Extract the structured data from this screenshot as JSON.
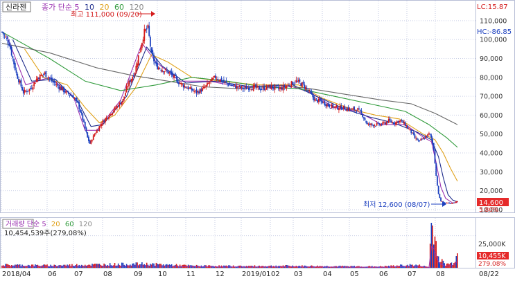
{
  "colors": {
    "up": "#d41b1b",
    "down": "#1b3fbf",
    "ma5": "#9a30b0",
    "ma10": "#1c2a8a",
    "ma20": "#e0a11a",
    "ma60": "#2f9a3a",
    "ma120": "#666666",
    "last_badge": "#e52a2a",
    "grid": "#c9cfe6",
    "frame": "#b7bed6"
  },
  "price_panel": {
    "stock_name": "신라젠",
    "ma_legend": [
      {
        "label": "종가 단순 5",
        "color": "#9a30b0"
      },
      {
        "label": "10",
        "color": "#1c2a8a"
      },
      {
        "label": "20",
        "color": "#e0a11a"
      },
      {
        "label": "60",
        "color": "#2f9a3a"
      },
      {
        "label": "120",
        "color": "#777777"
      }
    ],
    "lc_label": "LC:15.87",
    "hc_label": "HC:-86.85",
    "high_annotation": "최고 111,000 (09/20)",
    "low_annotation": "최저 12,600 (08/07)",
    "last_price": "14,600",
    "last_change": "5.80%",
    "y_ticks": [
      "110,000",
      "100,000",
      "90,000",
      "80,000",
      "70,000",
      "60,000",
      "50,000",
      "40,000",
      "30,000",
      "20,000",
      "10,000"
    ]
  },
  "volume_panel": {
    "title": "거래량 단순 5",
    "ma_legend": [
      {
        "label": "20",
        "color": "#e0a11a"
      },
      {
        "label": "60",
        "color": "#2f9a3a"
      },
      {
        "label": "120",
        "color": "#777777"
      }
    ],
    "volume_info": "10,454,539주(279,08%)",
    "y_tick": "25,000K",
    "last_volume": "10,455K",
    "last_ratio": "279.08%"
  },
  "x_axis": {
    "labels": [
      "2018/04",
      "06",
      "07",
      "08",
      "09",
      "10",
      "11",
      "12",
      "2019/01",
      "02",
      "03",
      "04",
      "05",
      "06",
      "07",
      "08",
      "08/22"
    ]
  },
  "chart_data": {
    "type": "candlestick",
    "x_labels": [
      "2018/04",
      "06",
      "07",
      "08",
      "09",
      "10",
      "11",
      "12",
      "2019/01",
      "02",
      "03",
      "04",
      "05",
      "06",
      "07",
      "08",
      "08/22"
    ],
    "price_y_range": [
      10000,
      118000
    ],
    "volume_y_range": [
      0,
      35000
    ],
    "volume_unit": "K",
    "close_series": {
      "name": "종가",
      "points": [
        [
          0,
          104000
        ],
        [
          6,
          98000
        ],
        [
          12,
          82000
        ],
        [
          18,
          72000
        ],
        [
          24,
          74000
        ],
        [
          30,
          80000
        ],
        [
          36,
          82000
        ],
        [
          42,
          78000
        ],
        [
          48,
          75000
        ],
        [
          54,
          72000
        ],
        [
          60,
          70000
        ],
        [
          64,
          66000
        ],
        [
          68,
          58000
        ],
        [
          72,
          48000
        ],
        [
          74,
          45000
        ],
        [
          78,
          50000
        ],
        [
          84,
          56000
        ],
        [
          90,
          60000
        ],
        [
          96,
          64000
        ],
        [
          102,
          68000
        ],
        [
          106,
          76000
        ],
        [
          112,
          83000
        ],
        [
          116,
          94000
        ],
        [
          120,
          104000
        ],
        [
          123,
          106000
        ],
        [
          126,
          92000
        ],
        [
          130,
          86000
        ],
        [
          136,
          84000
        ],
        [
          142,
          82000
        ],
        [
          148,
          78000
        ],
        [
          152,
          76000
        ],
        [
          158,
          74000
        ],
        [
          164,
          72000
        ],
        [
          170,
          74000
        ],
        [
          176,
          78000
        ],
        [
          180,
          80000
        ],
        [
          186,
          78000
        ],
        [
          192,
          76000
        ],
        [
          198,
          75000
        ],
        [
          204,
          74000
        ],
        [
          210,
          75000
        ],
        [
          218,
          74000
        ],
        [
          226,
          75000
        ],
        [
          234,
          74000
        ],
        [
          242,
          76000
        ],
        [
          248,
          78000
        ],
        [
          254,
          76000
        ],
        [
          258,
          73000
        ],
        [
          264,
          68000
        ],
        [
          270,
          67000
        ],
        [
          276,
          65000
        ],
        [
          282,
          64000
        ],
        [
          288,
          64000
        ],
        [
          294,
          63000
        ],
        [
          300,
          63000
        ],
        [
          304,
          60000
        ],
        [
          308,
          55000
        ],
        [
          314,
          55000
        ],
        [
          320,
          55000
        ],
        [
          326,
          57000
        ],
        [
          330,
          56000
        ],
        [
          336,
          57000
        ],
        [
          340,
          55000
        ],
        [
          344,
          52000
        ],
        [
          348,
          48000
        ],
        [
          352,
          46000
        ],
        [
          356,
          48000
        ],
        [
          360,
          50000
        ],
        [
          362,
          48000
        ],
        [
          364,
          42000
        ],
        [
          366,
          28000
        ],
        [
          368,
          18000
        ],
        [
          370,
          14500
        ],
        [
          372,
          14000
        ],
        [
          374,
          13500
        ],
        [
          376,
          13500
        ],
        [
          378,
          13000
        ],
        [
          380,
          13500
        ],
        [
          382,
          14000
        ],
        [
          384,
          14600
        ]
      ]
    },
    "moving_averages": [
      {
        "name": "5",
        "color": "#9a30b0",
        "points": [
          [
            4,
            102000
          ],
          [
            20,
            76000
          ],
          [
            40,
            80000
          ],
          [
            60,
            70000
          ],
          [
            70,
            52000
          ],
          [
            80,
            52000
          ],
          [
            100,
            68000
          ],
          [
            118,
            98000
          ],
          [
            130,
            88000
          ],
          [
            150,
            78000
          ],
          [
            175,
            78000
          ],
          [
            200,
            75000
          ],
          [
            240,
            76000
          ],
          [
            260,
            72000
          ],
          [
            280,
            64000
          ],
          [
            300,
            62000
          ],
          [
            320,
            55000
          ],
          [
            340,
            55000
          ],
          [
            356,
            48000
          ],
          [
            362,
            46000
          ],
          [
            366,
            35000
          ],
          [
            370,
            22000
          ],
          [
            374,
            16000
          ],
          [
            380,
            13500
          ],
          [
            384,
            13800
          ]
        ]
      },
      {
        "name": "10",
        "color": "#1c2a8a",
        "points": [
          [
            9,
            100000
          ],
          [
            25,
            78000
          ],
          [
            45,
            79000
          ],
          [
            65,
            66000
          ],
          [
            75,
            54000
          ],
          [
            85,
            55000
          ],
          [
            105,
            70000
          ],
          [
            122,
            96000
          ],
          [
            135,
            86000
          ],
          [
            155,
            77000
          ],
          [
            180,
            78000
          ],
          [
            210,
            75000
          ],
          [
            245,
            76000
          ],
          [
            265,
            70000
          ],
          [
            290,
            63000
          ],
          [
            310,
            59000
          ],
          [
            330,
            56000
          ],
          [
            350,
            51000
          ],
          [
            362,
            47000
          ],
          [
            368,
            38000
          ],
          [
            372,
            27000
          ],
          [
            376,
            18000
          ],
          [
            380,
            15000
          ],
          [
            384,
            14200
          ]
        ]
      },
      {
        "name": "20",
        "color": "#e0a11a",
        "points": [
          [
            19,
            95000
          ],
          [
            35,
            80000
          ],
          [
            55,
            76000
          ],
          [
            70,
            64000
          ],
          [
            82,
            56000
          ],
          [
            95,
            60000
          ],
          [
            112,
            74000
          ],
          [
            126,
            92000
          ],
          [
            140,
            88000
          ],
          [
            160,
            80000
          ],
          [
            185,
            78000
          ],
          [
            215,
            76000
          ],
          [
            250,
            76000
          ],
          [
            270,
            69000
          ],
          [
            295,
            63000
          ],
          [
            315,
            60000
          ],
          [
            335,
            58000
          ],
          [
            355,
            50000
          ],
          [
            365,
            47000
          ],
          [
            372,
            40000
          ],
          [
            378,
            32000
          ],
          [
            384,
            25000
          ]
        ]
      },
      {
        "name": "60",
        "color": "#2f9a3a",
        "points": [
          [
            0,
            104000
          ],
          [
            40,
            90000
          ],
          [
            70,
            78000
          ],
          [
            100,
            73000
          ],
          [
            130,
            76000
          ],
          [
            160,
            80000
          ],
          [
            190,
            78000
          ],
          [
            220,
            75000
          ],
          [
            250,
            74000
          ],
          [
            280,
            70000
          ],
          [
            310,
            66000
          ],
          [
            340,
            62000
          ],
          [
            360,
            55000
          ],
          [
            375,
            48000
          ],
          [
            384,
            43000
          ]
        ]
      },
      {
        "name": "120",
        "color": "#666666",
        "points": [
          [
            0,
            98000
          ],
          [
            40,
            93000
          ],
          [
            80,
            85000
          ],
          [
            110,
            81000
          ],
          [
            140,
            78000
          ],
          [
            170,
            75000
          ],
          [
            200,
            74000
          ],
          [
            230,
            76000
          ],
          [
            260,
            74000
          ],
          [
            290,
            71000
          ],
          [
            320,
            68000
          ],
          [
            345,
            66000
          ],
          [
            365,
            61000
          ],
          [
            384,
            55000
          ]
        ]
      }
    ],
    "extremes": {
      "high": 111000,
      "high_date": "09/20",
      "low": 12600,
      "low_date": "08/07"
    },
    "volume_profile": [
      [
        0,
        2200
      ],
      [
        40,
        1800
      ],
      [
        80,
        2500
      ],
      [
        120,
        3000
      ],
      [
        160,
        1600
      ],
      [
        200,
        1300
      ],
      [
        240,
        1500
      ],
      [
        280,
        1200
      ],
      [
        320,
        1000
      ],
      [
        344,
        2200
      ],
      [
        352,
        1800
      ],
      [
        360,
        600
      ],
      [
        362,
        33000
      ],
      [
        364,
        30000
      ],
      [
        366,
        18000
      ],
      [
        368,
        9000
      ],
      [
        370,
        6000
      ],
      [
        372,
        4000
      ],
      [
        374,
        2500
      ],
      [
        376,
        3000
      ],
      [
        380,
        3500
      ],
      [
        384,
        10455
      ]
    ]
  }
}
